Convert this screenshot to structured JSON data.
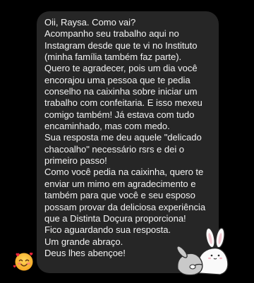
{
  "message": {
    "lines": [
      "Oii, Raysa. Como vai?",
      "Acompanho seu trabalho aqui no",
      "Instagram desde que te vi no Instituto",
      "(minha família também faz parte).",
      "Quero te agradecer, pois um dia você",
      "encorajou uma pessoa que te pedia",
      "conselho na caixinha sobre iniciar um",
      "trabalho com confeitaria. E isso mexeu",
      "comigo também! Já estava com tudo",
      "encaminhado, mas com medo.",
      "Sua resposta me deu aquele \"delicado",
      "chacoalho\" necessário rsrs e dei o",
      "primeiro passo!",
      "Como você pedia na caixinha, quero te",
      "enviar um mimo em agradecimento e",
      "também para que você e seu esposo",
      "possam provar da deliciosa experiência",
      "que a Distinta Doçura proporciona!",
      "Fico aguardando sua resposta.",
      "Um grande abraço.",
      "Deus lhes abençoe!"
    ]
  },
  "reaction": {
    "icon": "smiling-face-with-hearts-emoji"
  },
  "sticker": {
    "icon": "bunny-hug-sticker"
  },
  "colors": {
    "background": "#000000",
    "bubble": "#262626",
    "text": "#f2f2f2"
  }
}
